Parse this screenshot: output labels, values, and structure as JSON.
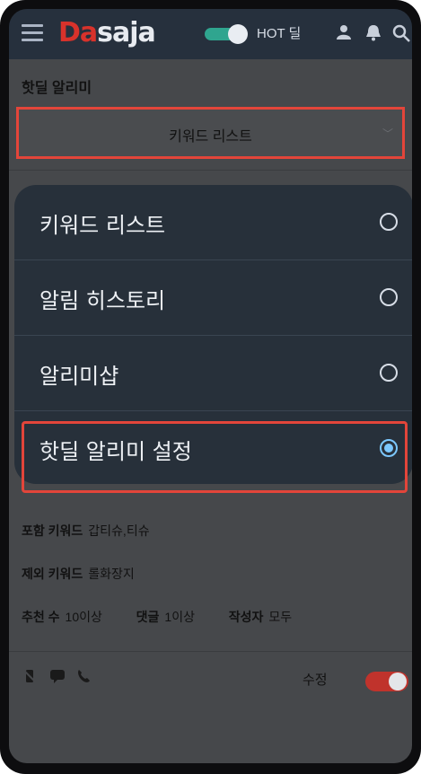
{
  "header": {
    "logo_part1": "Da",
    "logo_part2": "saja",
    "hot_label": "HOT 딜"
  },
  "page": {
    "title": "핫딜 알리미",
    "select_value": "키워드 리스트"
  },
  "dialog": {
    "options": [
      {
        "label": "키워드 리스트",
        "selected": false
      },
      {
        "label": "알림 히스토리",
        "selected": false
      },
      {
        "label": "알리미샵",
        "selected": false
      },
      {
        "label": "핫딜 알리미 설정",
        "selected": true
      }
    ]
  },
  "alert_card": {
    "include_label": "포함 키워드",
    "include_value": "갑티슈,티슈",
    "exclude_label": "제외 키워드",
    "exclude_value": "롤화장지",
    "recommend_label": "추천 수",
    "recommend_value": "10이상",
    "comment_label": "댓글",
    "comment_value": "1이상",
    "author_label": "작성자",
    "author_value": "모두",
    "edit_label": "수정"
  },
  "colors": {
    "accent_red": "#e3453a",
    "radio_selected": "#7cc8ff",
    "toggle_green": "#2fa58f"
  }
}
